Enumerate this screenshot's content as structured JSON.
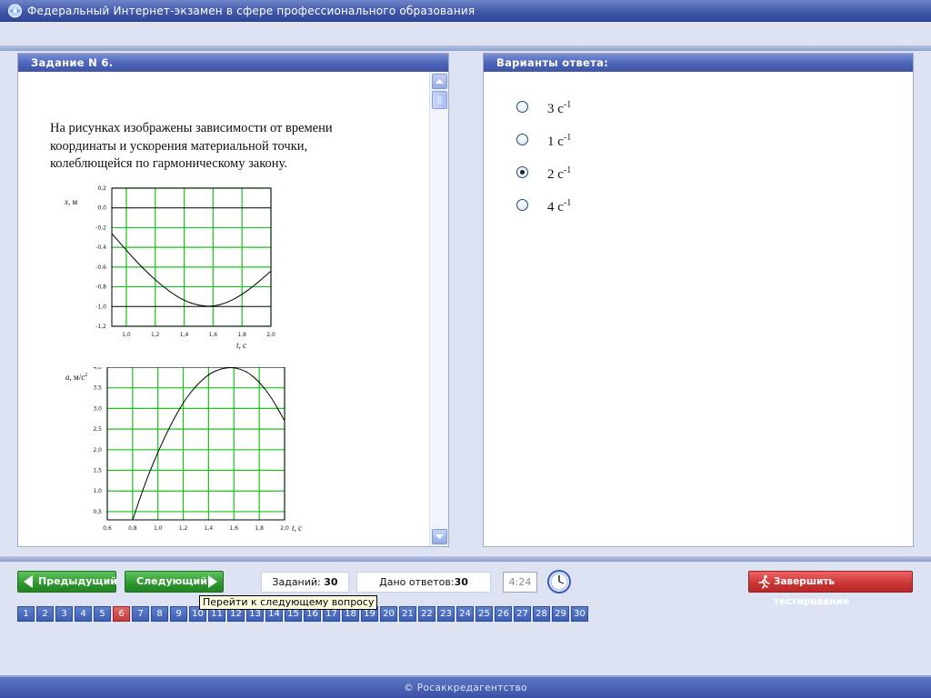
{
  "window": {
    "title": "Федеральный Интернет-экзамен в сфере профессионального образования"
  },
  "task": {
    "header": "Задание N 6.",
    "text": "На рисунках изображены зависимости от времени координаты и ускорения материальной точки, колеблющейся по гармоническому закону."
  },
  "answers": {
    "header": "Варианты ответа:",
    "options": [
      {
        "value": "3",
        "unit": "c",
        "exp": "-1",
        "checked": false
      },
      {
        "value": "1",
        "unit": "c",
        "exp": "-1",
        "checked": false
      },
      {
        "value": "2",
        "unit": "c",
        "exp": "-1",
        "checked": true
      },
      {
        "value": "4",
        "unit": "c",
        "exp": "-1",
        "checked": false
      }
    ]
  },
  "nav": {
    "prev_label": "Предыдущий",
    "next_label": "Следующий",
    "tasks_label": "Заданий:",
    "tasks_count": "30",
    "given_label": "Дано ответов:",
    "given_count": "30",
    "timer": "4:24",
    "finish_label": "Завершить тестирование",
    "tooltip": "Перейти к следующему вопросу"
  },
  "pager": {
    "pages": [
      "1",
      "2",
      "3",
      "4",
      "5",
      "6",
      "7",
      "8",
      "9",
      "10",
      "11",
      "12",
      "13",
      "14",
      "15",
      "16",
      "17",
      "18",
      "19",
      "20",
      "21",
      "22",
      "23",
      "24",
      "25",
      "26",
      "27",
      "28",
      "29",
      "30"
    ],
    "current": "6"
  },
  "footer": {
    "text": "© Росаккредагентство"
  },
  "colors": {
    "grid": "#19c319",
    "accent": "#3f55a6",
    "current_page": "#c43b3b"
  },
  "chart_data": [
    {
      "type": "line",
      "ylabel_var": "x",
      "ylabel_unit": ", м",
      "xlabel_var": "t",
      "xlabel_unit": ", с",
      "xlim": [
        0.9,
        2.0
      ],
      "ylim": [
        -1.2,
        0.2
      ],
      "xticks": [
        "1,0",
        "1,2",
        "1,4",
        "1,6",
        "1,8",
        "2,0"
      ],
      "yticks": [
        "0,2",
        "0,0",
        "-0,2",
        "-0,4",
        "-0,6",
        "-0,8",
        "-1,0",
        "-1,2"
      ],
      "x": [
        0.9,
        1.0,
        1.1,
        1.2,
        1.3,
        1.4,
        1.5,
        1.6,
        1.7,
        1.8,
        1.9,
        2.0
      ],
      "y": [
        -0.26,
        -0.43,
        -0.59,
        -0.73,
        -0.85,
        -0.94,
        -0.99,
        -1.0,
        -0.96,
        -0.88,
        -0.77,
        -0.64
      ]
    },
    {
      "type": "line",
      "ylabel_var": "a",
      "ylabel_unit": ", м/с",
      "ylabel_exp": "2",
      "xlabel_var": "t",
      "xlabel_unit": ", с",
      "xlim": [
        0.6,
        2.0
      ],
      "ylim": [
        0.3,
        4.0
      ],
      "xticks": [
        "0,6",
        "0,8",
        "1,0",
        "1,2",
        "1,4",
        "1,6",
        "1,8",
        "2,0"
      ],
      "yticks": [
        "4,0",
        "3,5",
        "3,0",
        "2,5",
        "2,0",
        "1,5",
        "1,0",
        "0,5"
      ],
      "x": [
        0.8,
        0.9,
        1.0,
        1.1,
        1.2,
        1.3,
        1.4,
        1.5,
        1.6,
        1.7,
        1.8,
        1.9,
        2.0
      ],
      "y": [
        0.3,
        1.2,
        1.95,
        2.6,
        3.15,
        3.55,
        3.83,
        3.97,
        4.0,
        3.9,
        3.65,
        3.25,
        2.7
      ]
    }
  ]
}
